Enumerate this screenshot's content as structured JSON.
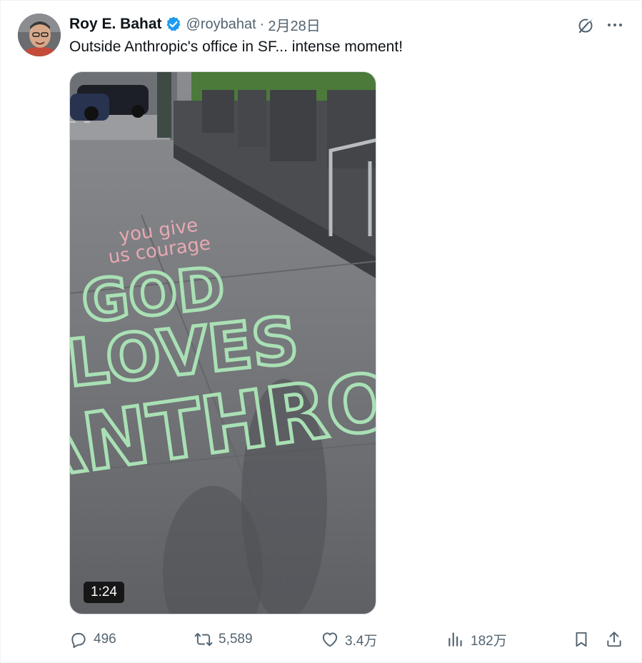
{
  "tweet": {
    "author_name": "Roy E. Bahat",
    "handle": "@roybahat",
    "separator": "·",
    "date": "2月28日",
    "text": "Outside Anthropic's office in SF... intense moment!",
    "verified": true
  },
  "media": {
    "type": "video",
    "duration": "1:24",
    "chalk_lines": [
      "you give",
      "us courage",
      "GOD",
      "LOVES",
      "ANTHRO"
    ]
  },
  "actions": {
    "replies": "496",
    "reposts": "5,589",
    "likes": "3.4万",
    "views": "182万"
  },
  "icons": {
    "avatar": "avatar",
    "verified": "verified-badge-icon",
    "grok": "grok-icon",
    "more": "more-icon",
    "reply": "reply-icon",
    "repost": "repost-icon",
    "like": "heart-icon",
    "views": "views-icon",
    "bookmark": "bookmark-icon",
    "share": "share-icon"
  },
  "colors": {
    "text": "#0f1419",
    "secondary": "#536471",
    "verified": "#1d9bf0"
  }
}
